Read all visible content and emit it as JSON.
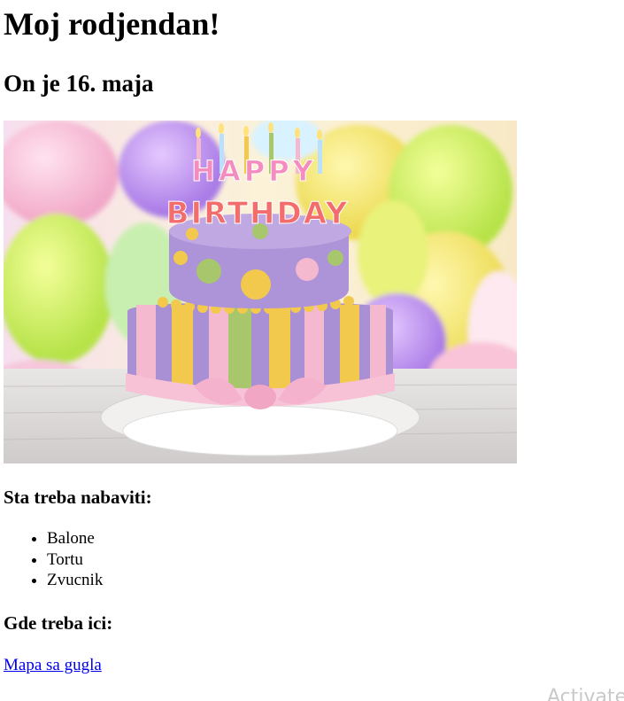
{
  "page": {
    "title": "Moj rodjendan!",
    "subtitle": "On je 16. maja"
  },
  "image": {
    "icon": "birthday-cake-photo",
    "text": "HAPPY BIRTHDAY"
  },
  "shopping": {
    "heading": "Sta treba nabaviti:",
    "items": [
      "Balone",
      "Tortu",
      "Zvucnik"
    ]
  },
  "location": {
    "heading": "Gde treba ici:",
    "link_text": "Mapa sa gugla"
  },
  "watermark": "Activate",
  "colors": {
    "link": "#0000ee",
    "cake_purple": "#a98fd4",
    "cake_pink": "#f4b8cf",
    "cake_yellow": "#f2c94c",
    "cake_green": "#a8c66c"
  }
}
